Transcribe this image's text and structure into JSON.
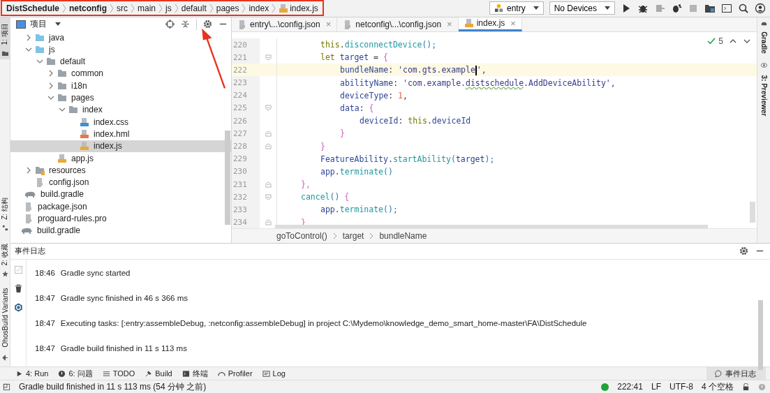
{
  "navbar": {
    "crumbs": [
      {
        "label": "DistSchedule",
        "bold": true
      },
      {
        "label": "netconfig",
        "bold": true
      },
      {
        "label": "src",
        "bold": false
      },
      {
        "label": "main",
        "bold": false
      },
      {
        "label": "js",
        "bold": false
      },
      {
        "label": "default",
        "bold": false
      },
      {
        "label": "pages",
        "bold": false
      },
      {
        "label": "index",
        "bold": false
      },
      {
        "label": "index.js",
        "bold": false,
        "kind": "js"
      }
    ],
    "config": "entry",
    "device": "No Devices"
  },
  "left_stripe": [
    "1: 项目",
    "Z: 结构",
    "2: 收藏",
    "OhosBuild Variants"
  ],
  "right_stripe": [
    "Gradle",
    "3: Previewer"
  ],
  "project": {
    "title": "项目",
    "tree": [
      {
        "children": [
          {
            "children": [
              {
                "name": "java",
                "kind": "source-folder",
                "expanded": false,
                "selected": false
              },
              {
                "name": "js",
                "kind": "source-folder",
                "expanded": true,
                "selected": false,
                "children": [
                  {
                    "name": "default",
                    "kind": "folder",
                    "expanded": true,
                    "selected": false,
                    "children": [
                      {
                        "name": "common",
                        "kind": "folder",
                        "expanded": false,
                        "selected": false
                      },
                      {
                        "name": "i18n",
                        "kind": "folder",
                        "expanded": false,
                        "selected": false
                      },
                      {
                        "name": "pages",
                        "kind": "folder",
                        "expanded": true,
                        "selected": false,
                        "children": [
                          {
                            "name": "index",
                            "kind": "folder",
                            "expanded": true,
                            "selected": false,
                            "children": [
                              {
                                "name": "index.css",
                                "kind": "css",
                                "selected": false
                              },
                              {
                                "name": "index.hml",
                                "kind": "html",
                                "selected": false
                              },
                              {
                                "name": "index.js",
                                "kind": "js",
                                "selected": true
                              }
                            ]
                          }
                        ]
                      },
                      {
                        "name": "app.js",
                        "kind": "js",
                        "selected": false
                      }
                    ]
                  }
                ]
              },
              {
                "name": "resources",
                "kind": "resource-folder",
                "expanded": false,
                "selected": false
              },
              {
                "name": "config.json",
                "kind": "json",
                "selected": false
              }
            ]
          },
          {
            "name": "build.gradle",
            "kind": "gradle",
            "selected": false
          },
          {
            "name": "package.json",
            "kind": "json",
            "selected": false
          },
          {
            "name": "proguard-rules.pro",
            "kind": "text",
            "selected": false
          }
        ]
      },
      {
        "name": "build.gradle",
        "kind": "gradle",
        "selected": false
      }
    ]
  },
  "editor": {
    "tabs": [
      {
        "label": "entry\\...\\config.json",
        "kind": "json",
        "selected": false,
        "close": "×"
      },
      {
        "label": "netconfig\\...\\config.json",
        "kind": "json",
        "selected": false,
        "close": "×"
      },
      {
        "label": "index.js",
        "kind": "js",
        "selected": true,
        "close": "×"
      }
    ],
    "inspection": "5",
    "lines": [
      {
        "children": [
          {
            "no": "220",
            "current": false,
            "fold_start": false,
            "fold_end": false,
            "tokens": [
              {
                "text": "this",
                "kind": "kw"
              },
              {
                "text": ".",
                "kind": "plain"
              },
              {
                "text": "disconnectDevice",
                "kind": "fn"
              },
              {
                "text": "();",
                "kind": "paren"
              }
            ]
          },
          {
            "no": "221",
            "current": false,
            "fold_start": true,
            "fold_end": false,
            "tokens": [
              {
                "text": "let",
                "kind": "kw"
              },
              {
                "text": "target",
                "kind": "prop"
              },
              {
                "text": "=",
                "kind": "plain"
              },
              {
                "text": "{",
                "kind": "brace"
              }
            ],
            "children": [
              {
                "no": "222",
                "current": true,
                "fold_start": false,
                "fold_end": false,
                "tokens": [
                  {
                    "text": "bundleName",
                    "kind": "prop"
                  },
                  {
                    "text": ":",
                    "kind": "plain"
                  },
                  {
                    "text": "'com.gts.example",
                    "kind": "str",
                    "caret": true
                  },
                  {
                    "text": "',",
                    "kind": "str"
                  }
                ]
              },
              {
                "no": "223",
                "current": false,
                "fold_start": false,
                "fold_end": false,
                "tokens": [
                  {
                    "text": "abilityName",
                    "kind": "prop"
                  },
                  {
                    "text": ":",
                    "kind": "plain"
                  },
                  {
                    "text": "'com.example.",
                    "kind": "str"
                  },
                  {
                    "text": "distschedule",
                    "kind": "str",
                    "typo": true
                  },
                  {
                    "text": ".AddDeviceAbility',",
                    "kind": "str"
                  }
                ]
              },
              {
                "no": "224",
                "current": false,
                "fold_start": false,
                "fold_end": false,
                "tokens": [
                  {
                    "text": "deviceType",
                    "kind": "prop"
                  },
                  {
                    "text": ":",
                    "kind": "plain"
                  },
                  {
                    "text": "1",
                    "kind": "num"
                  },
                  {
                    "text": ",",
                    "kind": "plain"
                  }
                ]
              },
              {
                "no": "225",
                "current": false,
                "fold_start": true,
                "fold_end": false,
                "tokens": [
                  {
                    "text": "data",
                    "kind": "prop"
                  },
                  {
                    "text": ":",
                    "kind": "plain"
                  },
                  {
                    "text": "{",
                    "kind": "brace"
                  }
                ],
                "children": [
                  {
                    "no": "226",
                    "current": false,
                    "fold_start": false,
                    "fold_end": false,
                    "tokens": [
                      {
                        "text": "deviceId",
                        "kind": "prop"
                      },
                      {
                        "text": ":",
                        "kind": "plain"
                      },
                      {
                        "text": "this",
                        "kind": "kw"
                      },
                      {
                        "text": ".",
                        "kind": "plain"
                      },
                      {
                        "text": "deviceId",
                        "kind": "prop"
                      }
                    ]
                  }
                ]
              },
              {
                "no": "227",
                "current": false,
                "fold_start": false,
                "fold_end": true,
                "tokens": [
                  {
                    "text": "}",
                    "kind": "brace"
                  }
                ]
              }
            ]
          },
          {
            "no": "228",
            "current": false,
            "fold_start": false,
            "fold_end": true,
            "tokens": [
              {
                "text": "}",
                "kind": "brace"
              }
            ]
          },
          {
            "no": "229",
            "current": false,
            "fold_start": false,
            "fold_end": false,
            "tokens": [
              {
                "text": "FeatureAbility",
                "kind": "prop"
              },
              {
                "text": ".",
                "kind": "plain"
              },
              {
                "text": "startAbility",
                "kind": "fn"
              },
              {
                "text": "(",
                "kind": "paren"
              },
              {
                "text": "target",
                "kind": "prop"
              },
              {
                "text": ");",
                "kind": "paren"
              }
            ]
          },
          {
            "no": "230",
            "current": false,
            "fold_start": false,
            "fold_end": false,
            "tokens": [
              {
                "text": "app",
                "kind": "prop"
              },
              {
                "text": ".",
                "kind": "plain"
              },
              {
                "text": "terminate",
                "kind": "fn"
              },
              {
                "text": "()",
                "kind": "paren"
              }
            ]
          }
        ]
      },
      {
        "no": "231",
        "current": false,
        "fold_start": false,
        "fold_end": true,
        "tokens": [
          {
            "text": "},",
            "kind": "brace"
          }
        ]
      },
      {
        "no": "232",
        "current": false,
        "fold_start": true,
        "fold_end": false,
        "tokens": [
          {
            "text": "cancel",
            "kind": "fn"
          },
          {
            "text": "()",
            "kind": "paren"
          },
          {
            "text": "{",
            "kind": "brace"
          }
        ],
        "children": [
          {
            "no": "233",
            "current": false,
            "fold_start": false,
            "fold_end": false,
            "tokens": [
              {
                "text": "app",
                "kind": "prop"
              },
              {
                "text": ".",
                "kind": "plain"
              },
              {
                "text": "terminate",
                "kind": "fn"
              },
              {
                "text": "();",
                "kind": "paren"
              }
            ]
          }
        ]
      },
      {
        "no": "234",
        "current": false,
        "fold_start": false,
        "fold_end": true,
        "tokens": [
          {
            "text": "}",
            "kind": "brace"
          }
        ]
      }
    ],
    "breadcrumb": [
      "goToControl()",
      "target",
      "bundleName"
    ]
  },
  "event_log": {
    "title": "事件日志",
    "entries": [
      {
        "time": "18:46",
        "message": "Gradle sync started"
      },
      {
        "time": "18:47",
        "message": "Gradle sync finished in 46 s 366 ms"
      },
      {
        "time": "18:47",
        "message": "Executing tasks: [:entry:assembleDebug, :netconfig:assembleDebug] in project C:\\Mydemo\\knowledge_demo_smart_home-master\\FA\\DistSchedule"
      },
      {
        "time": "18:47",
        "message": "Gradle build finished in 11 s 113 ms"
      }
    ]
  },
  "tool_windows": [
    {
      "label": "4: Run",
      "kind": "run"
    },
    {
      "label": "6: 问题",
      "kind": "problems"
    },
    {
      "label": "TODO",
      "kind": "todo"
    },
    {
      "label": "Build",
      "kind": "build"
    },
    {
      "label": "终端",
      "kind": "terminal"
    },
    {
      "label": "Profiler",
      "kind": "profiler"
    },
    {
      "label": "Log",
      "kind": "log"
    }
  ],
  "event_log_button": "事件日志",
  "status_bar": {
    "message": "Gradle build finished in 11 s 113 ms (54 分钟 之前)",
    "position": "222:41",
    "line_sep": "LF",
    "encoding": "UTF-8",
    "indent": "4 个空格"
  }
}
